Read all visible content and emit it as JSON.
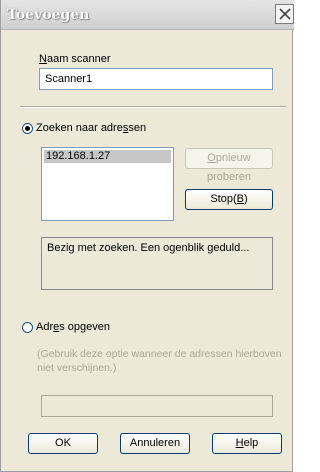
{
  "window": {
    "title": "Toevoegen"
  },
  "scanner_name": {
    "label_accel": "N",
    "label_rest": "aam scanner",
    "value": "Scanner1"
  },
  "search_option": {
    "label_pre": "Zoeken naar adre",
    "label_accel": "s",
    "label_post": "sen",
    "selected": true
  },
  "address_list": {
    "items": [
      "192.168.1.27"
    ],
    "selected_index": 0
  },
  "buttons": {
    "retry_accel": "O",
    "retry_rest": "pnieuw proberen",
    "retry_enabled": false,
    "stop_pre": "Stop(",
    "stop_accel": "B",
    "stop_post": ")",
    "ok": "OK",
    "cancel": "Annuleren",
    "help_accel": "H",
    "help_rest": "elp"
  },
  "status": {
    "text": "Bezig met zoeken. Een ogenblik geduld..."
  },
  "address_option": {
    "label_pre": "Adr",
    "label_accel": "e",
    "label_post": "s opgeven",
    "selected": false,
    "hint": "(Gebruik deze optie wanneer de adressen hierboven niet verschijnen.)",
    "value": ""
  },
  "colors": {
    "dialog_bg": "#ece9d8",
    "selection": "#c6c6c6",
    "disabled_text": "#aca899"
  }
}
